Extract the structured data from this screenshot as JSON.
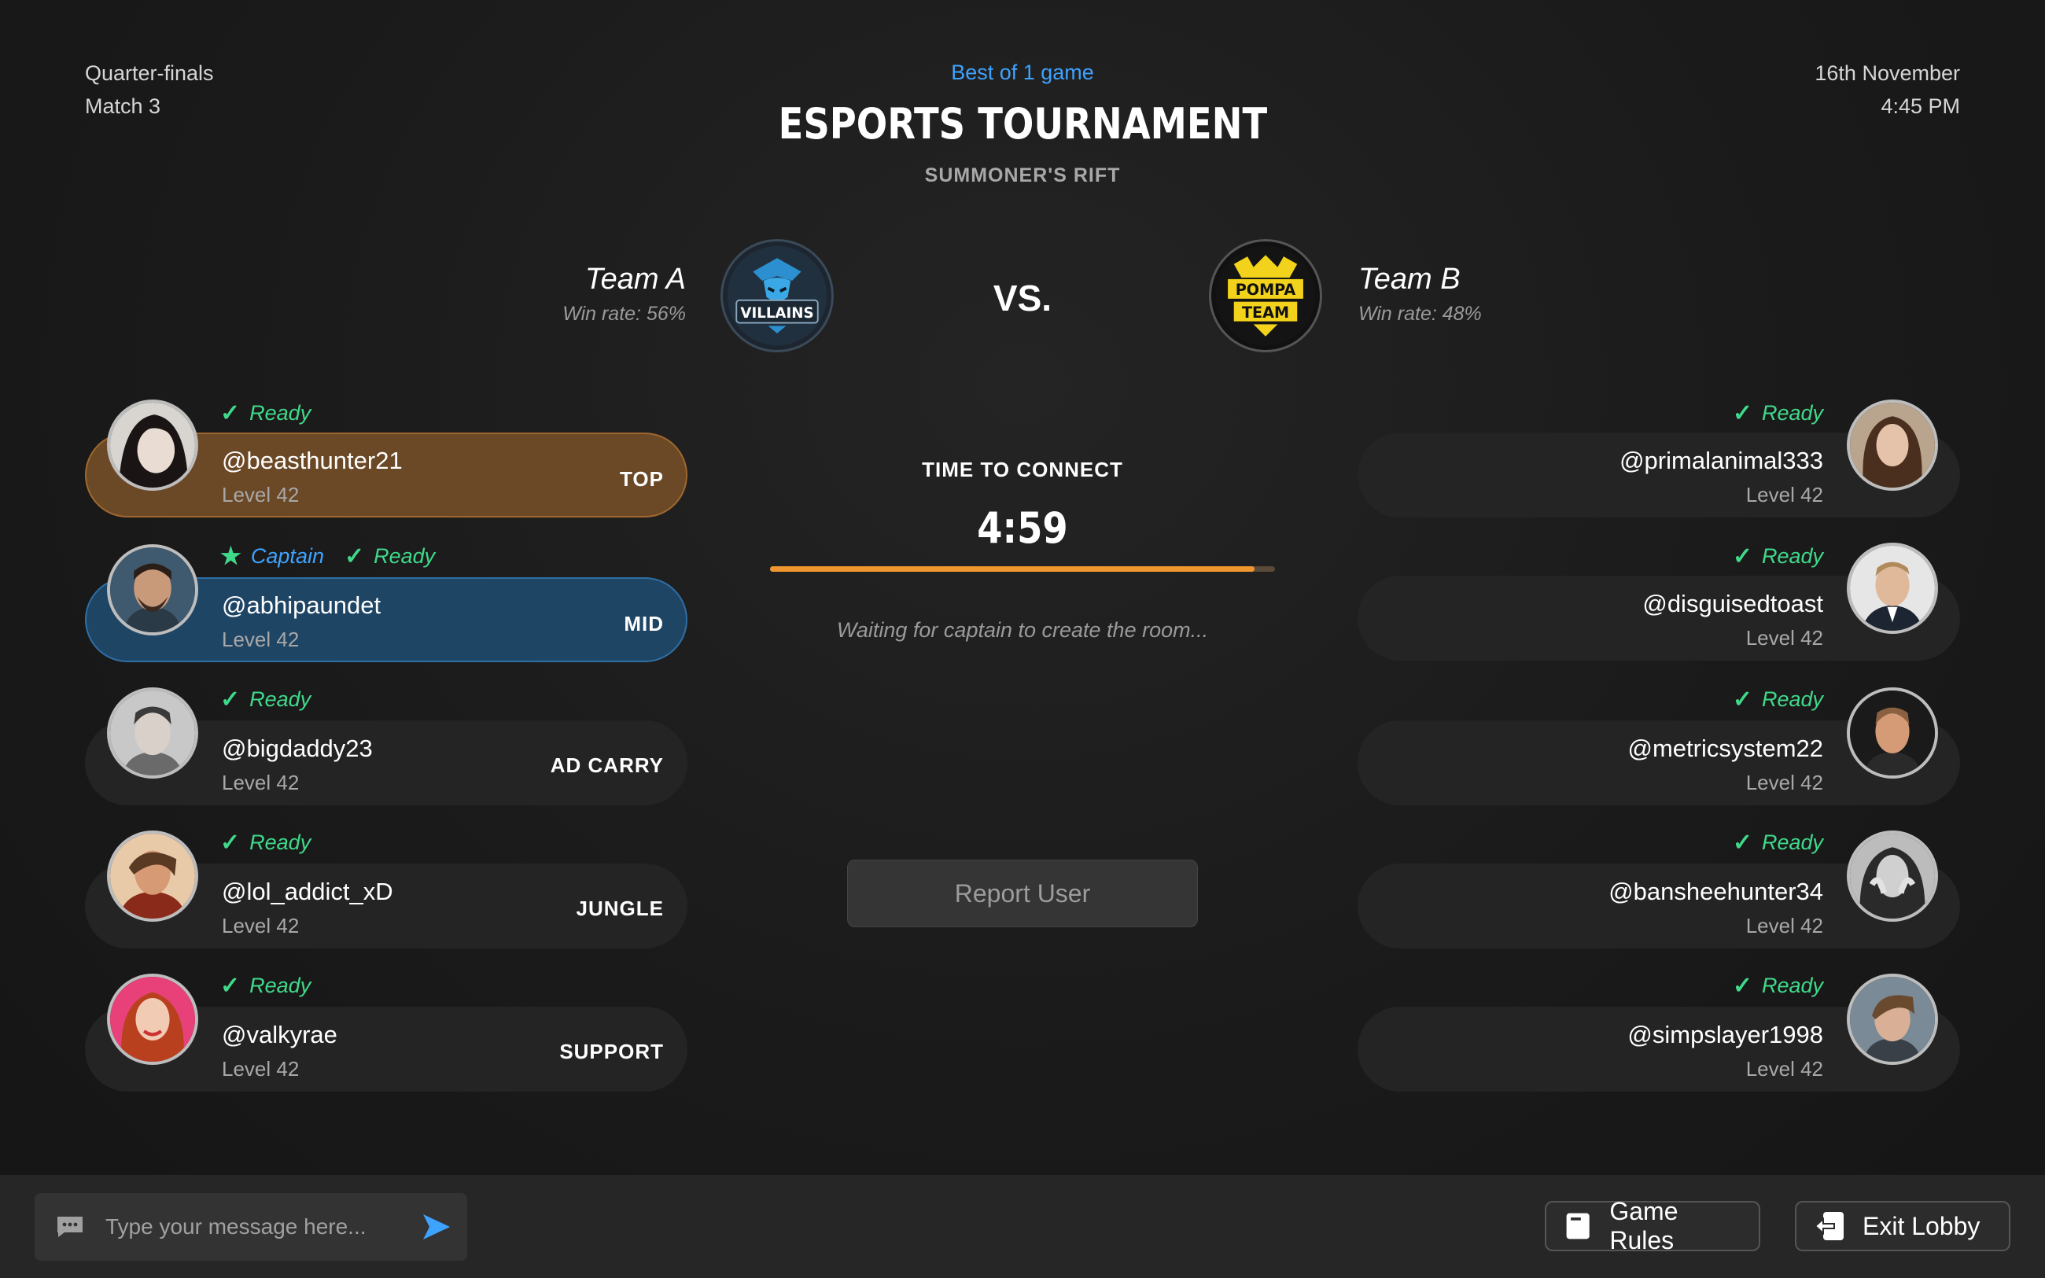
{
  "header": {
    "stage": "Quarter-finals",
    "match": "Match 3",
    "best_of": "Best of 1 game",
    "title": "ESPORTS TOURNAMENT",
    "map": "SUMMONER'S RIFT",
    "date": "16th November",
    "time": "4:45 PM"
  },
  "teams": {
    "a": {
      "name": "Team A",
      "win_rate": "Win rate: 56%",
      "logo_text": "VILLAINS"
    },
    "vs": "VS.",
    "b": {
      "name": "Team B",
      "win_rate": "Win rate: 48%",
      "logo_text": [
        "POMPA",
        "TEAM"
      ]
    }
  },
  "team_a_players": [
    {
      "status": "Ready",
      "username": "@beasthunter21",
      "level": "Level 42",
      "role": "TOP"
    },
    {
      "captain": "Captain",
      "status": "Ready",
      "username": "@abhipaundet",
      "level": "Level 42",
      "role": "MID"
    },
    {
      "status": "Ready",
      "username": "@bigdaddy23",
      "level": "Level 42",
      "role": "AD CARRY"
    },
    {
      "status": "Ready",
      "username": "@lol_addict_xD",
      "level": "Level 42",
      "role": "JUNGLE"
    },
    {
      "status": "Ready",
      "username": "@valkyrae",
      "level": "Level 42",
      "role": "SUPPORT"
    }
  ],
  "team_b_players": [
    {
      "status": "Ready",
      "username": "@primalanimal333",
      "level": "Level 42"
    },
    {
      "status": "Ready",
      "username": "@disguisedtoast",
      "level": "Level 42"
    },
    {
      "status": "Ready",
      "username": "@metricsystem22",
      "level": "Level 42"
    },
    {
      "status": "Ready",
      "username": "@bansheehunter34",
      "level": "Level 42"
    },
    {
      "status": "Ready",
      "username": "@simpslayer1998",
      "level": "Level 42"
    }
  ],
  "center": {
    "time_label": "TIME TO CONNECT",
    "timer": "4:59",
    "progress_fraction": 0.96,
    "waiting_text": "Waiting for captain to create the room...",
    "report_button": "Report User"
  },
  "footer": {
    "message_placeholder": "Type your message here...",
    "game_rules_button": "Game Rules",
    "exit_lobby_button": "Exit Lobby"
  },
  "colors": {
    "accent_blue": "#3ea3ff",
    "ready_green": "#40d98a",
    "top_role_card": "#6b4826",
    "mid_role_card": "#1f4565",
    "progress_orange": "#f0962e"
  },
  "icons": {
    "ready": "check-icon",
    "captain": "star-icon",
    "message": "chat-bubble-icon",
    "send": "send-arrow-icon",
    "rules": "document-icon",
    "exit": "exit-arrow-icon"
  }
}
